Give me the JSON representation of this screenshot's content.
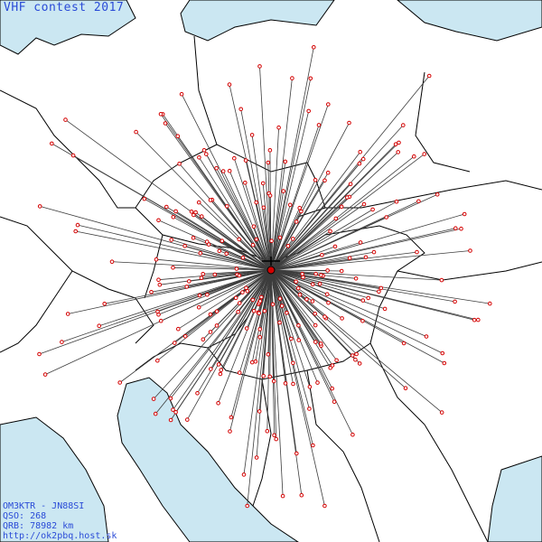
{
  "map": {
    "title": "VHF contest 2017",
    "station_line": "OM3KTR - JN88SI",
    "qso_line": "QSO: 268",
    "odx_line": "QRB: 78982 km",
    "website": "http://ok2pbq.host.sk",
    "colors": {
      "sea": "#cbe7f2",
      "land": "#ffffff",
      "border": "#000000",
      "line": "#3d3d3d",
      "contact_point": "#d40000",
      "title_text": "#2a4bd7"
    },
    "home_station": {
      "label": "OM3KTR",
      "locator": "JN88SI"
    }
  }
}
